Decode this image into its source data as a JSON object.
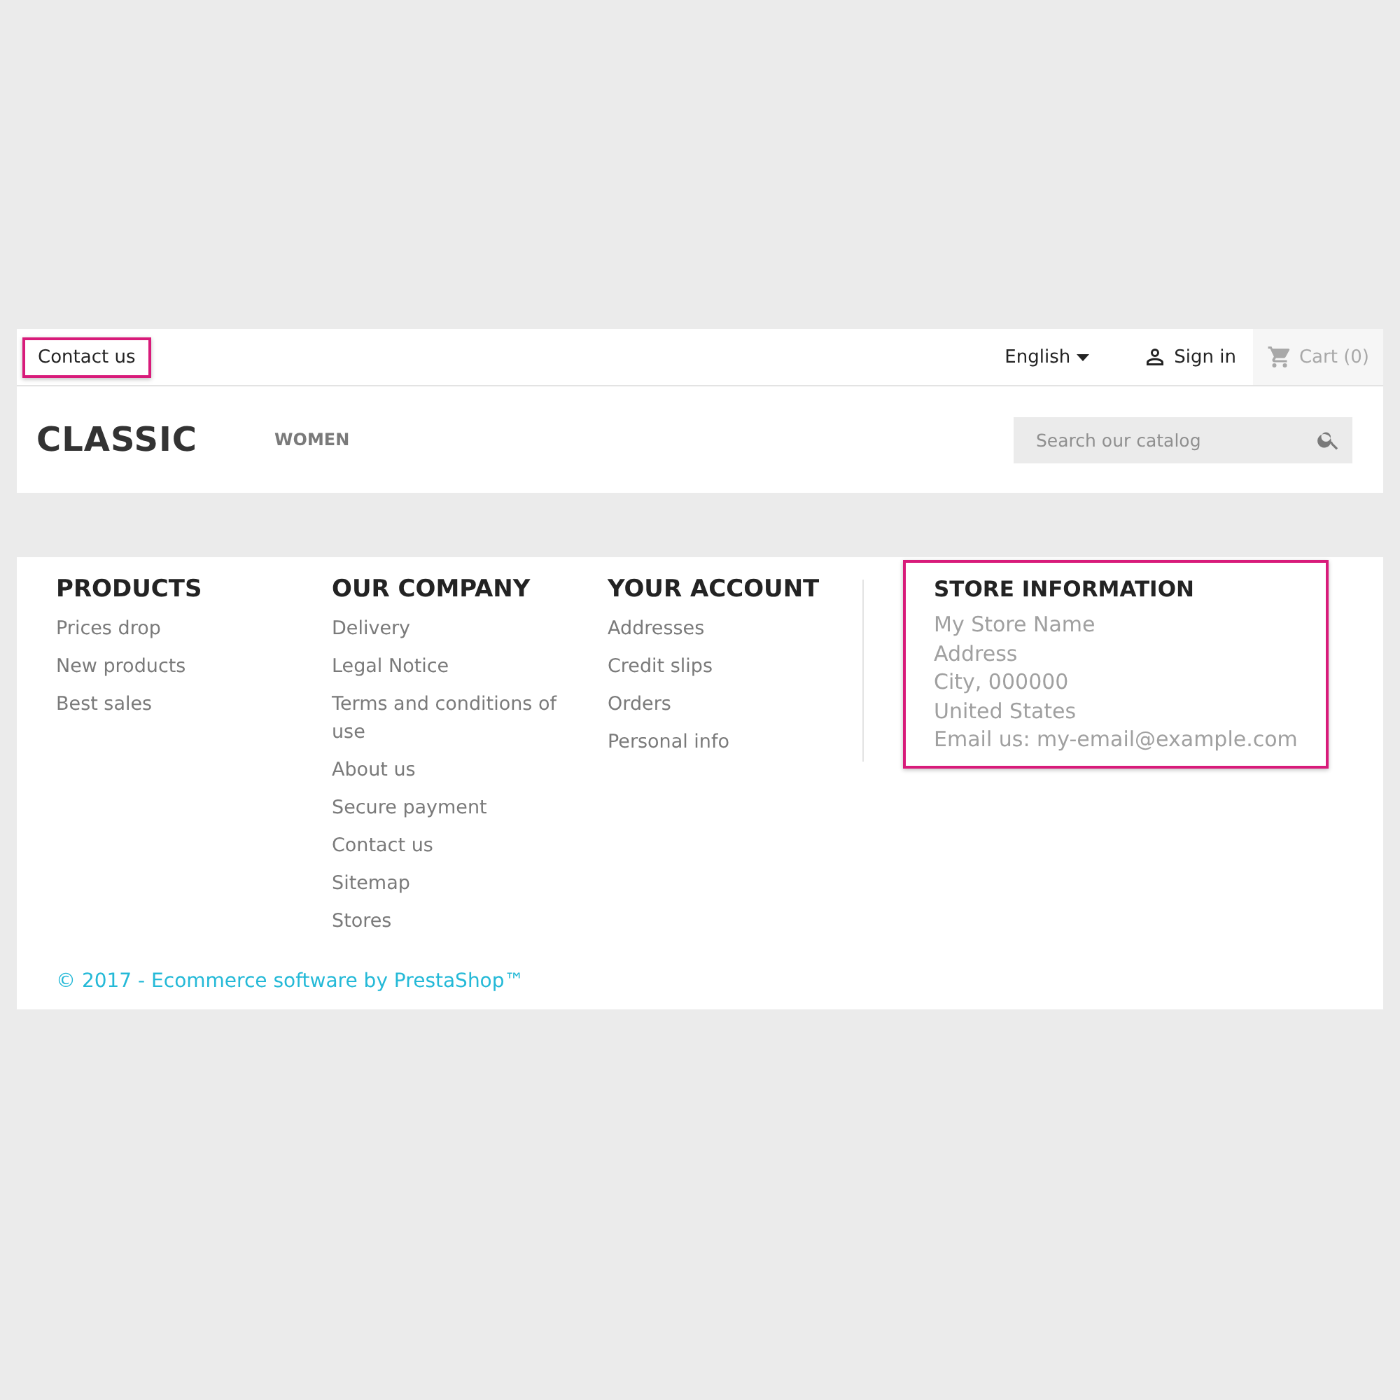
{
  "header": {
    "contact_link": {
      "label": "Contact us",
      "highlighted": true
    },
    "language": "English",
    "sign_in": "Sign in",
    "cart": {
      "label": "Cart (0)",
      "disabled": true
    },
    "logo": "CLASSIC",
    "menu": [
      "WOMEN"
    ],
    "search": {
      "placeholder": "Search our catalog"
    }
  },
  "footer": {
    "columns": [
      {
        "title": "PRODUCTS",
        "links": [
          "Prices drop",
          "New products",
          "Best sales"
        ]
      },
      {
        "title": "OUR COMPANY",
        "links": [
          "Delivery",
          "Legal Notice",
          "Terms and conditions of use",
          "About us",
          "Secure payment",
          "Contact us",
          "Sitemap",
          "Stores"
        ]
      },
      {
        "title": "YOUR ACCOUNT",
        "links": [
          "Addresses",
          "Credit slips",
          "Orders",
          "Personal info"
        ]
      }
    ],
    "store_info": {
      "title": "STORE INFORMATION",
      "lines": [
        "My Store Name",
        "Address",
        "City, 000000",
        "United States",
        "Email us: my-email@example.com"
      ],
      "highlighted": true
    },
    "copyright": "© 2017 - Ecommerce software by PrestaShop™"
  }
}
